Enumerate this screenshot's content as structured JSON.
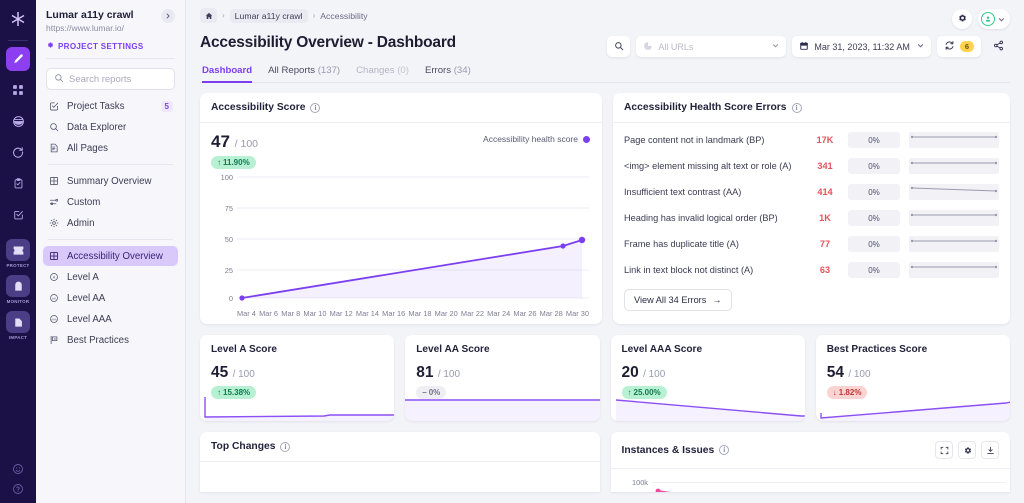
{
  "rail": {
    "logo_icon": "lumar-asterisk-logo",
    "items": [
      {
        "name": "edit-tool",
        "icon": "pencil-icon",
        "active": true
      },
      {
        "name": "dashboard",
        "icon": "grid-icon",
        "active": false
      },
      {
        "name": "analytics",
        "icon": "pie-icon",
        "active": false
      },
      {
        "name": "crawl",
        "icon": "refresh-icon",
        "active": false
      },
      {
        "name": "tasks",
        "icon": "clipboard-icon",
        "active": false
      },
      {
        "name": "checks",
        "icon": "checklist-icon",
        "active": false
      }
    ],
    "products": [
      {
        "label": "PROTECT",
        "icon": "protect-icon"
      },
      {
        "label": "MONITOR",
        "icon": "monitor-icon"
      },
      {
        "label": "IMPACT",
        "icon": "impact-icon"
      }
    ],
    "bottom": [
      {
        "name": "feedback-icon"
      },
      {
        "name": "help-icon"
      }
    ]
  },
  "sidebar": {
    "project_name": "Lumar a11y crawl",
    "project_url": "https://www.lumar.io/",
    "settings_label": "PROJECT SETTINGS",
    "settings_icon": "gear-icon",
    "expand_icon": "chevron-right-icon",
    "search": {
      "placeholder": "Search reports",
      "value": "",
      "icon": "search-icon"
    },
    "groups": [
      {
        "items": [
          {
            "label": "Project Tasks",
            "icon": "task-icon",
            "badge": "5",
            "active": false
          },
          {
            "label": "Data Explorer",
            "icon": "magnifier-icon",
            "badge": "",
            "active": false
          },
          {
            "label": "All Pages",
            "icon": "pages-icon",
            "badge": "",
            "active": false
          }
        ]
      },
      {
        "items": [
          {
            "label": "Summary Overview",
            "icon": "grid-icon",
            "badge": "",
            "active": false
          },
          {
            "label": "Custom",
            "icon": "sliders-icon",
            "badge": "",
            "active": false
          },
          {
            "label": "Admin",
            "icon": "gear-icon",
            "badge": "",
            "active": false
          }
        ]
      },
      {
        "items": [
          {
            "label": "Accessibility Overview",
            "icon": "grid-icon",
            "badge": "",
            "active": true
          },
          {
            "label": "Level A",
            "icon": "circle-a-icon",
            "badge": "",
            "active": false
          },
          {
            "label": "Level AA",
            "icon": "circle-aa-icon",
            "badge": "",
            "active": false
          },
          {
            "label": "Level AAA",
            "icon": "circle-aaa-icon",
            "badge": "",
            "active": false
          },
          {
            "label": "Best Practices",
            "icon": "flag-icon",
            "badge": "",
            "active": false
          }
        ]
      }
    ]
  },
  "header": {
    "breadcrumb": {
      "home_icon": "home-icon",
      "items": [
        "Lumar a11y crawl",
        "Accessibility"
      ],
      "separator": "›"
    },
    "title": "Accessibility Overview - Dashboard",
    "tabs": [
      {
        "label": "Dashboard",
        "count": "",
        "active": true,
        "disabled": false
      },
      {
        "label": "All Reports",
        "count": "(137)",
        "active": false,
        "disabled": false
      },
      {
        "label": "Changes",
        "count": "(0)",
        "active": false,
        "disabled": true
      },
      {
        "label": "Errors",
        "count": "(34)",
        "active": false,
        "disabled": false
      }
    ],
    "settings_icon": "gear-icon",
    "account_icon": "account-avatar-icon",
    "account_chevron": "chevron-down-icon",
    "search_icon": "search-icon",
    "url_filter": {
      "placeholder": "All URLs",
      "icon": "segment-icon",
      "chevron": "chevron-down-icon"
    },
    "date_picker": {
      "value": "Mar 31, 2023, 11:32 AM",
      "icon": "calendar-icon",
      "chevron": "chevron-down-icon"
    },
    "crawl": {
      "icon": "refresh-icon",
      "badge": "6"
    },
    "share_icon": "share-icon"
  },
  "accessibility_score": {
    "title": "Accessibility Score",
    "info_icon": "info-icon",
    "value": "47",
    "denominator": "/ 100",
    "delta": {
      "text": "11.90%",
      "direction": "up",
      "arrow": "↑"
    },
    "legend": {
      "label": "Accessibility health score",
      "color": "#7b3ff0"
    }
  },
  "chart_data": {
    "type": "line",
    "title": "Accessibility Score",
    "ylabel": "",
    "xlabel": "",
    "ylim": [
      0,
      100
    ],
    "yticks": [
      "0",
      "25",
      "50",
      "75",
      "100"
    ],
    "grid": true,
    "legend_position": "top-right",
    "series": [
      {
        "name": "Accessibility health score",
        "color": "#7b3ff0",
        "x": [
          "Mar 3",
          "Mar 29",
          "Mar 31"
        ],
        "values": [
          0,
          42,
          47
        ]
      }
    ],
    "categories": [
      "Mar 4",
      "Mar 6",
      "Mar 8",
      "Mar 10",
      "Mar 12",
      "Mar 14",
      "Mar 16",
      "Mar 18",
      "Mar 20",
      "Mar 22",
      "Mar 24",
      "Mar 26",
      "Mar 28",
      "Mar 30"
    ]
  },
  "errors_panel": {
    "title": "Accessibility Health Score Errors",
    "info_icon": "info-icon",
    "rows": [
      {
        "name": "Page content not in landmark (BP)",
        "count": "17K",
        "pct": "0%"
      },
      {
        "name": "<img> element missing alt text or role (A)",
        "count": "341",
        "pct": "0%"
      },
      {
        "name": "Insufficient text contrast (AA)",
        "count": "414",
        "pct": "0%"
      },
      {
        "name": "Heading has invalid logical order (BP)",
        "count": "1K",
        "pct": "0%"
      },
      {
        "name": "Frame has duplicate title (A)",
        "count": "77",
        "pct": "0%"
      },
      {
        "name": "Link in text block not distinct (A)",
        "count": "63",
        "pct": "0%"
      }
    ],
    "view_all_label": "View All 34 Errors",
    "view_all_arrow": "→"
  },
  "score_cards": [
    {
      "title": "Level A Score",
      "value": "45",
      "denominator": "/ 100",
      "delta_text": "15.38%",
      "delta_dir": "up",
      "arrow": "↑"
    },
    {
      "title": "Level AA Score",
      "value": "81",
      "denominator": "/ 100",
      "delta_text": "0%",
      "delta_dir": "flat",
      "arrow": "–"
    },
    {
      "title": "Level AAA Score",
      "value": "20",
      "denominator": "/ 100",
      "delta_text": "25.00%",
      "delta_dir": "up",
      "arrow": "↑"
    },
    {
      "title": "Best Practices Score",
      "value": "54",
      "denominator": "/ 100",
      "delta_text": "1.82%",
      "delta_dir": "down",
      "arrow": "↓"
    }
  ],
  "top_changes": {
    "title": "Top Changes",
    "info_icon": "info-icon"
  },
  "instances_issues": {
    "title": "Instances & Issues",
    "info_icon": "info-icon",
    "ytick": "100k",
    "actions": [
      {
        "name": "expand-icon"
      },
      {
        "name": "gear-icon"
      },
      {
        "name": "download-icon"
      }
    ]
  },
  "colors": {
    "accent": "#7b3ff0",
    "rail_bg": "#1b1147",
    "error_red": "#e4545b",
    "success_green": "#0f7a4e",
    "pink": "#f0479a"
  }
}
